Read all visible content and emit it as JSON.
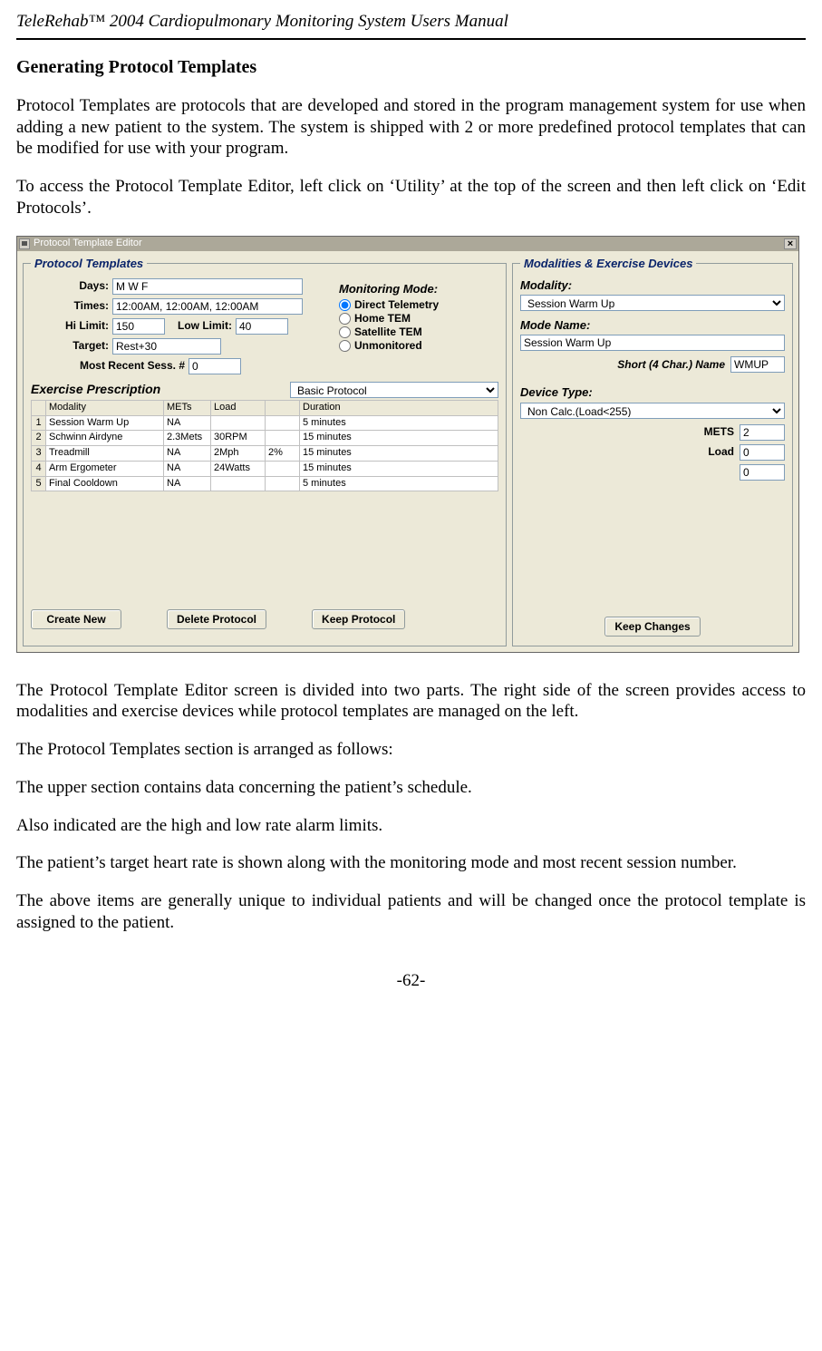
{
  "header": "TeleRehab™ 2004 Cardiopulmonary Monitoring System Users Manual",
  "heading": "Generating Protocol Templates",
  "para1": "Protocol Templates are protocols that are developed and stored in the program management system for use when adding a new patient to the system. The system is shipped with 2 or more predefined protocol templates that can be modified for use with your program.",
  "para2": "To access the Protocol Template Editor, left click on ‘Utility’ at the top of the screen and then left click on ‘Edit Protocols’.",
  "para3": "The Protocol Template Editor screen is divided into two parts. The right side of the screen provides access to modalities and exercise devices while protocol templates are managed on the left.",
  "para4": "The Protocol Templates section is arranged as follows:",
  "para5": "The upper section contains data concerning the patient’s schedule.",
  "para6": "Also indicated are the high and low rate alarm limits.",
  "para7": "The patient’s target heart rate is shown along with the monitoring mode and most recent session number.",
  "para8": "The above items are generally unique to individual patients and will be changed once the protocol template is assigned to the patient.",
  "page_num": "-62-",
  "window": {
    "title": "Protocol Template Editor",
    "close": "×",
    "left": {
      "legend": "Protocol Templates",
      "days_label": "Days:",
      "days_value": "M W F",
      "times_label": "Times:",
      "times_value": "12:00AM, 12:00AM, 12:00AM",
      "hilimit_label": "Hi Limit:",
      "hilimit_value": "150",
      "lowlimit_label": "Low Limit:",
      "lowlimit_value": "40",
      "target_label": "Target:",
      "target_value": "Rest+30",
      "sess_label": "Most Recent Sess. #",
      "sess_value": "0",
      "mon_heading": "Monitoring Mode:",
      "mon_opts": [
        "Direct Telemetry",
        "Home TEM",
        "Satellite TEM",
        "Unmonitored"
      ],
      "mon_selected": 0,
      "exerc_heading": "Exercise Prescription",
      "protocol_select": "Basic Protocol",
      "table": {
        "headers": [
          "",
          "Modality",
          "METs",
          "Load",
          "",
          "Duration"
        ],
        "rows": [
          [
            "1",
            "Session Warm Up",
            "NA",
            "",
            "",
            "5 minutes"
          ],
          [
            "2",
            "Schwinn Airdyne",
            "2.3Mets",
            "30RPM",
            "",
            "15 minutes"
          ],
          [
            "3",
            "Treadmill",
            "NA",
            "2Mph",
            "2%",
            "15 minutes"
          ],
          [
            "4",
            "Arm Ergometer",
            "NA",
            "24Watts",
            "",
            "15 minutes"
          ],
          [
            "5",
            "Final Cooldown",
            "NA",
            "",
            "",
            "5 minutes"
          ]
        ]
      },
      "buttons": {
        "create": "Create New",
        "delete": "Delete Protocol",
        "keep": "Keep Protocol"
      }
    },
    "right": {
      "legend": "Modalities & Exercise Devices",
      "modality_label": "Modality:",
      "modality_value": "Session Warm Up",
      "modename_label": "Mode Name:",
      "modename_value": "Session Warm Up",
      "shortname_label": "Short (4 Char.) Name",
      "shortname_value": "WMUP",
      "device_label": "Device Type:",
      "device_value": "Non Calc.(Load<255)",
      "mets_label": "METS",
      "mets_value": "2",
      "load_label": "Load",
      "load_value": "0",
      "extra_value": "0",
      "keep_button": "Keep Changes"
    }
  }
}
